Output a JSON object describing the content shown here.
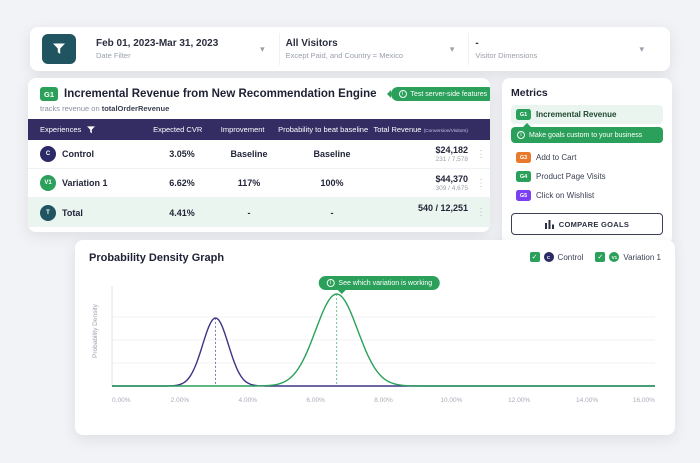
{
  "icons": {
    "info": "i",
    "chevron": "▾",
    "kebab": "⋮",
    "check": "✓"
  },
  "colors": {
    "accent_green": "#2AA05A",
    "table_header_indigo": "#332D64",
    "filter_button_teal": "#1F5460",
    "control_badge_navy": "#2B2A66",
    "orange_badge": "#E87A2E",
    "purple_badge": "#7B3FF2",
    "total_row_bg": "#E9F5EE"
  },
  "filter_bar": {
    "filters": [
      {
        "value": "Feb 01, 2023-Mar 31, 2023",
        "label": "Date Filter"
      },
      {
        "value": "All Visitors",
        "label": "Except Paid, and Country = Mexico"
      },
      {
        "value": "-",
        "label": "Visitor Dimensions"
      }
    ]
  },
  "report": {
    "goal_badge": "G1",
    "title": "Incremental Revenue from New Recommendation Engine",
    "callout": "Test server-side features",
    "subtitle_prefix": "tracks revenue on",
    "subtitle_metric": "totalOrderRevenue",
    "table": {
      "headers": [
        "Experiences",
        "Expected CVR",
        "Improvement",
        "Probability to beat baseline",
        "Total Revenue"
      ],
      "headers_suffix": "(Conversion/Visitors)",
      "rows": [
        {
          "badge": "C",
          "name": "Control",
          "cvr": "3.05%",
          "improvement": "Baseline",
          "probability": "Baseline",
          "revenue": "$24,182",
          "conversion": "231 / 7,578"
        },
        {
          "badge": "V1",
          "name": "Variation 1",
          "cvr": "6.62%",
          "improvement": "117%",
          "probability": "100%",
          "revenue": "$44,370",
          "conversion": "309 / 4,675"
        },
        {
          "badge": "T",
          "name": "Total",
          "cvr": "4.41%",
          "improvement": "-",
          "probability": "-",
          "revenue": "540 / 12,251",
          "conversion": ""
        }
      ]
    }
  },
  "metrics": {
    "title": "Metrics",
    "items": [
      {
        "badge": "G1",
        "label": "Incremental Revenue",
        "color": "#2AA05A",
        "active": true
      },
      {
        "badge": "G3",
        "label": "Add to Cart",
        "color": "#E87A2E",
        "active": false
      },
      {
        "badge": "G4",
        "label": "Product Page Visits",
        "color": "#2AA05A",
        "active": false
      },
      {
        "badge": "G5",
        "label": "Click on Wishlist",
        "color": "#7B3FF2",
        "active": false
      }
    ],
    "tooltip": "Make goals custom to your business",
    "compare_button": "COMPARE GOALS"
  },
  "chart_data": {
    "type": "line",
    "title": "Probability Density Graph",
    "xlabel": "",
    "ylabel": "Probability Density",
    "x_range": [
      0,
      16
    ],
    "x_ticks": [
      "0.00%",
      "2.00%",
      "4.00%",
      "6.00%",
      "8.00%",
      "10.00%",
      "12.00%",
      "14.00%",
      "16.00%"
    ],
    "grid": true,
    "legend_position": "top-right",
    "annotation": "See which variation is working",
    "legend": [
      {
        "badge": "C",
        "label": "Control",
        "checked": true
      },
      {
        "badge": "V1",
        "label": "Variation 1",
        "checked": true
      }
    ],
    "series": [
      {
        "name": "Control",
        "distribution": "normal",
        "color": "#3D3585",
        "mean": 3.05,
        "sd": 0.38,
        "peak": 0.74
      },
      {
        "name": "Variation 1",
        "distribution": "normal",
        "color": "#2AA05A",
        "mean": 6.62,
        "sd": 0.62,
        "peak": 1.0
      }
    ]
  }
}
